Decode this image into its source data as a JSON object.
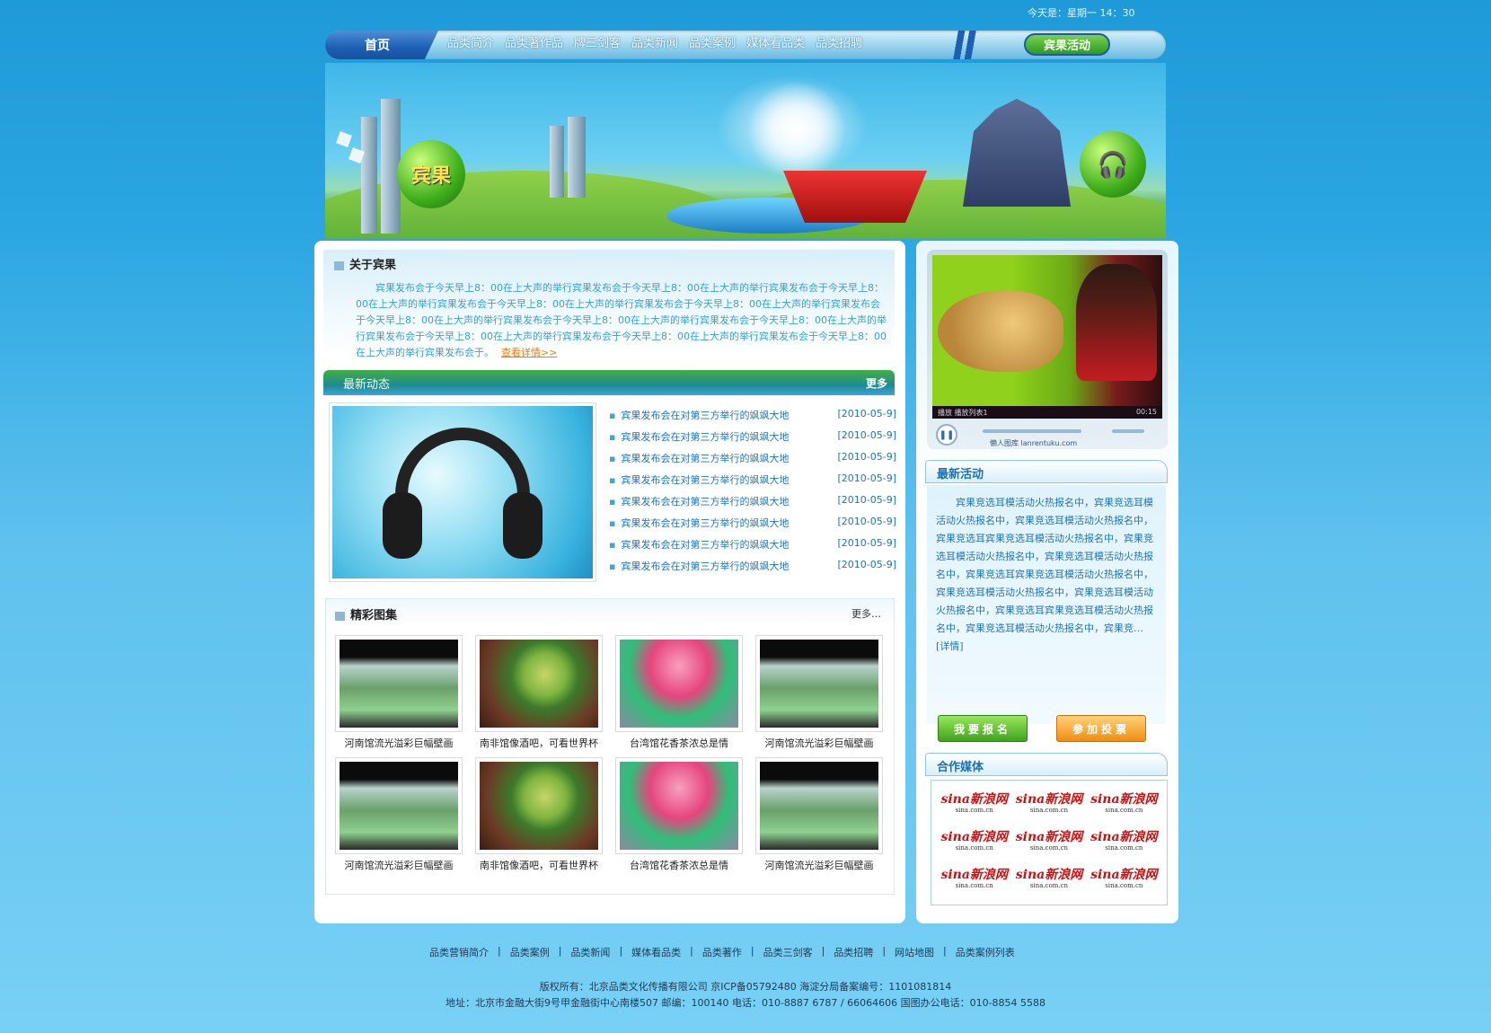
{
  "header": {
    "date": "今天是：星期一 14：30",
    "nav_home": "首页",
    "nav_items": [
      "品类简介",
      "品类著作品",
      "牌三剑客",
      "品类新闻",
      "品类案例",
      "媒体看品类",
      "品类招聘"
    ],
    "nav_promo": "宾果活动"
  },
  "banner": {
    "logo": "宾果"
  },
  "about": {
    "title": "关于宾果",
    "text": "宾果发布会于今天早上8：00在上大声的举行宾果发布会于今天早上8：00在上大声的举行宾果发布会于今天早上8：00在上大声的举行宾果发布会于今天早上8：00在上大声的举行宾果发布会于今天早上8：00在上大声的举行宾果发布会于今天早上8：00在上大声的举行宾果发布会于今天早上8：00在上大声的举行宾果发布会于今天早上8：00在上大声的举行宾果发布会于今天早上8：00在上大声的举行宾果发布会于今天早上8：00在上大声的举行宾果发布会于今天早上8：00在上大声的举行宾果发布会于。",
    "more": "查看详情>>"
  },
  "news": {
    "title": "最新动态",
    "more": "更多",
    "items": [
      {
        "title": "宾果发布会在对第三方举行的飒飒大地",
        "date": "[2010-05-9]"
      },
      {
        "title": "宾果发布会在对第三方举行的飒飒大地",
        "date": "[2010-05-9]"
      },
      {
        "title": "宾果发布会在对第三方举行的飒飒大地",
        "date": "[2010-05-9]"
      },
      {
        "title": "宾果发布会在对第三方举行的飒飒大地",
        "date": "[2010-05-9]"
      },
      {
        "title": "宾果发布会在对第三方举行的飒飒大地",
        "date": "[2010-05-9]"
      },
      {
        "title": "宾果发布会在对第三方举行的飒飒大地",
        "date": "[2010-05-9]"
      },
      {
        "title": "宾果发布会在对第三方举行的飒飒大地",
        "date": "[2010-05-9]"
      },
      {
        "title": "宾果发布会在对第三方举行的飒飒大地",
        "date": "[2010-05-9]"
      }
    ]
  },
  "gallery": {
    "title": "精彩图集",
    "more": "更多…",
    "items": [
      {
        "caption": "河南馆流光溢彩巨幅壁画",
        "pic": "a"
      },
      {
        "caption": "南非馆像酒吧，可看世界杯",
        "pic": "b"
      },
      {
        "caption": "台湾馆花香茶浓总是情",
        "pic": "c"
      },
      {
        "caption": "河南馆流光溢彩巨幅壁画",
        "pic": "a"
      },
      {
        "caption": "河南馆流光溢彩巨幅壁画",
        "pic": "a"
      },
      {
        "caption": "南非馆像酒吧，可看世界杯",
        "pic": "b"
      },
      {
        "caption": "台湾馆花香茶浓总是情",
        "pic": "c"
      },
      {
        "caption": "河南馆流光溢彩巨幅壁画",
        "pic": "a"
      }
    ]
  },
  "video": {
    "status_left": "播放 播放列表1",
    "status_right": "00:15",
    "brand": "懒人图库 lanrentuku.com"
  },
  "activity": {
    "title": "最新活动",
    "text": "宾果竞选耳模活动火热报名中，宾果竞选耳模活动火热报名中，宾果竞选耳模活动火热报名中，宾果竞选耳宾果竞选耳模活动火热报名中，宾果竞选耳模活动火热报名中，宾果竞选耳模活动火热报名中，宾果竞选耳宾果竞选耳模活动火热报名中，宾果竞选耳模活动火热报名中，宾果竞选耳模活动火热报名中，宾果竞选耳宾果竞选耳模活动火热报名中，宾果竞选耳模活动火热报名中，宾果竞…",
    "detail": "[详情]",
    "signup": "我要报名",
    "vote": "参加投票"
  },
  "media": {
    "title": "合作媒体",
    "logos": [
      "sina新浪网",
      "sina新浪网",
      "sina新浪网",
      "sina新浪网",
      "sina新浪网",
      "sina新浪网",
      "sina新浪网",
      "sina新浪网",
      "sina新浪网"
    ],
    "logo_sub": "sina.com.cn"
  },
  "footer": {
    "links": [
      "品类营销简介",
      "品类案例",
      "品类新闻",
      "媒体看品类",
      "品类著作",
      "品类三剑客",
      "品类招聘",
      "网站地图",
      "品类案例列表"
    ],
    "copyright": "版权所有：北京品类文化传播有限公司 京ICP备05792480 海淀分局备案编号：1101081814",
    "address": "地址：北京市金融大街9号甲金融街中心南楼507 邮编：100140 电话：010-8887 6787 / 66064606 国图办公电话：010-8854 5588"
  }
}
